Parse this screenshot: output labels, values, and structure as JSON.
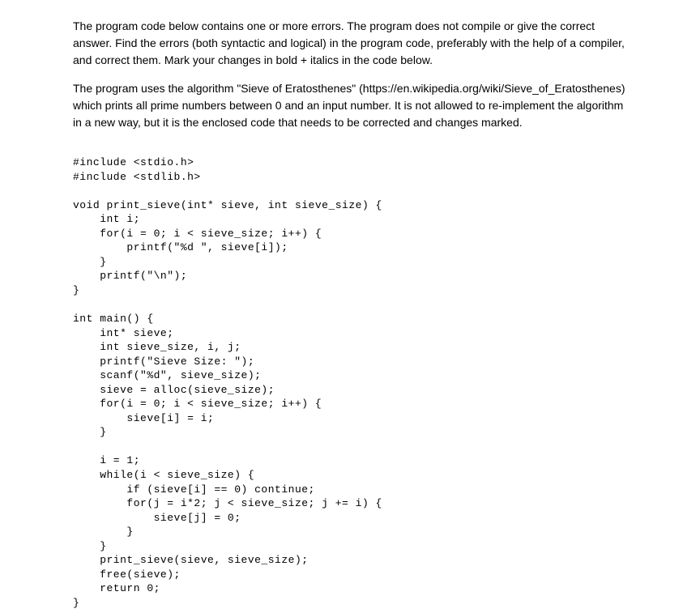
{
  "para1": "The program code below contains one or more errors. The program does not compile or give the correct answer. Find the errors (both syntactic and logical) in the program code, preferably with the help of a compiler, and correct them. Mark your changes in bold + italics in the code below.",
  "para2": "The program uses the algorithm \"Sieve of Eratosthenes\" (https://en.wikipedia.org/wiki/Sieve_of_Eratosthenes) which prints all prime numbers between 0 and an input number. It is not allowed to re-implement the algorithm in a new way, but it is the enclosed code that needs to be corrected and changes marked.",
  "code": "#include <stdio.h>\n#include <stdlib.h>\n\nvoid print_sieve(int* sieve, int sieve_size) {\n    int i;\n    for(i = 0; i < sieve_size; i++) {\n        printf(\"%d \", sieve[i]);\n    }\n    printf(\"\\n\");\n}\n\nint main() {\n    int* sieve;\n    int sieve_size, i, j;\n    printf(\"Sieve Size: \");\n    scanf(\"%d\", sieve_size);\n    sieve = alloc(sieve_size);\n    for(i = 0; i < sieve_size; i++) {\n        sieve[i] = i;\n    }\n\n    i = 1;\n    while(i < sieve_size) {\n        if (sieve[i] == 0) continue;\n        for(j = i*2; j < sieve_size; j += i) {\n            sieve[j] = 0;\n        }\n    }\n    print_sieve(sieve, sieve_size);\n    free(sieve);\n    return 0;\n}"
}
